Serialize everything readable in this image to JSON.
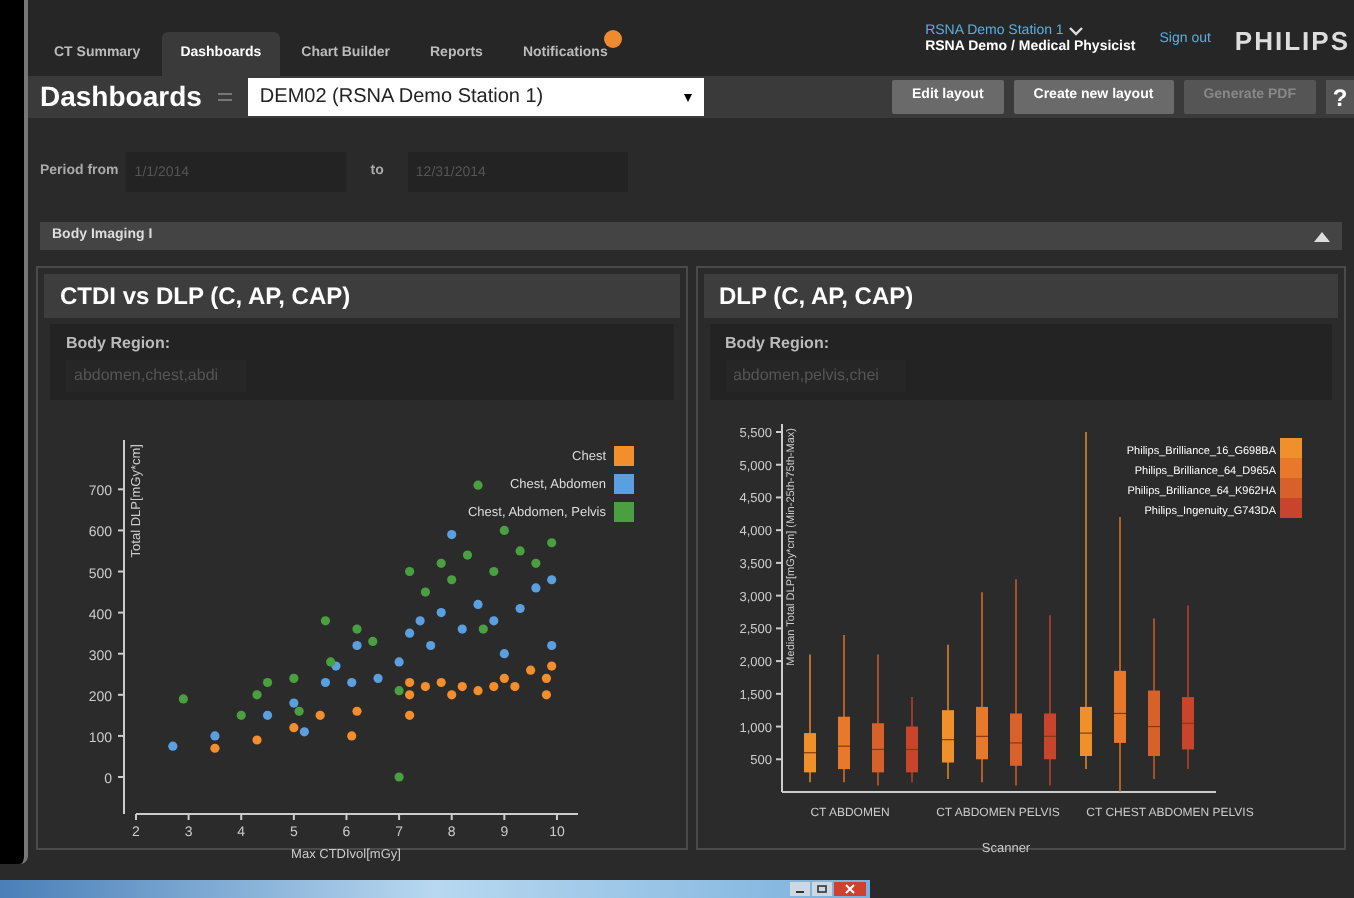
{
  "tabs": [
    {
      "label": "CT Summary",
      "selected": false
    },
    {
      "label": "Dashboards",
      "selected": true
    },
    {
      "label": "Chart Builder",
      "selected": false
    },
    {
      "label": "Reports",
      "selected": false
    },
    {
      "label": "Notifications",
      "selected": false,
      "badge": true
    }
  ],
  "user": {
    "station": "RSNA Demo Station 1",
    "role": "RSNA Demo / Medical Physicist"
  },
  "sign_out": "Sign out",
  "logo": "PHILIPS",
  "toolbar": {
    "title": "Dashboards",
    "dashboard_select": "DEM02 (RSNA Demo Station 1)",
    "buttons": [
      {
        "label": "Edit layout",
        "disabled": false
      },
      {
        "label": "Create new layout",
        "disabled": false
      },
      {
        "label": "Generate PDF",
        "disabled": true
      }
    ],
    "help": "?"
  },
  "period": {
    "from_label": "Period from",
    "from_placeholder": "1/1/2014",
    "to_label": "to",
    "to_placeholder": "12/31/2014"
  },
  "section": {
    "title": "Body Imaging I",
    "expanded": true
  },
  "panels": [
    {
      "title": "CTDI vs DLP (C, AP, CAP)",
      "filter_label": "Body Region:",
      "filter_placeholder": "abdomen,chest,abdi",
      "chart_data": {
        "type": "scatter",
        "xlabel": "Max CTDIvol[mGy]",
        "ylabel": "Total DLP[mGy*cm]",
        "xlim": [
          2,
          10.4
        ],
        "ylim": [
          -90,
          820
        ],
        "legend": "upper right",
        "xticks": [
          2,
          3,
          4,
          5,
          6,
          7,
          8,
          9,
          10
        ],
        "yticks": [
          0,
          100,
          200,
          300,
          400,
          500,
          600,
          700
        ],
        "series": [
          {
            "name": "Chest",
            "color": "#f28e2b",
            "x": [
              3.5,
              4.3,
              5,
              5.5,
              6.1,
              6.2,
              7.2,
              7.2,
              7.2,
              7.5,
              7.8,
              8,
              8.2,
              8.5,
              8.8,
              9,
              9.2,
              9.5,
              9.8,
              9.8,
              9.9
            ],
            "values": [
              70,
              90,
              120,
              150,
              100,
              160,
              150,
              200,
              230,
              220,
              230,
              200,
              220,
              210,
              220,
              240,
              220,
              260,
              200,
              240,
              270
            ]
          },
          {
            "name": "Chest, Abdomen",
            "color": "#5aa0e0",
            "x": [
              2.7,
              3.5,
              4.5,
              5,
              5.2,
              5.6,
              5.8,
              6.1,
              6.2,
              6.6,
              7,
              7.2,
              7.4,
              7.6,
              7.8,
              8,
              8.2,
              8.5,
              8.8,
              9,
              9.3,
              9.6,
              9.9,
              9.9
            ],
            "values": [
              75,
              100,
              150,
              180,
              110,
              230,
              270,
              230,
              320,
              240,
              280,
              350,
              380,
              320,
              400,
              590,
              360,
              420,
              380,
              300,
              410,
              460,
              480,
              320
            ]
          },
          {
            "name": "Chest, Abdomen, Pelvis",
            "color": "#4aa040",
            "x": [
              2.9,
              4,
              4.3,
              4.5,
              5,
              5.1,
              5.6,
              5.7,
              6.2,
              6.5,
              7,
              7,
              7.2,
              7.5,
              7.8,
              8,
              8.3,
              8.5,
              8.8,
              9,
              9.3,
              9.6,
              9.9,
              8.6
            ],
            "values": [
              190,
              150,
              200,
              230,
              240,
              160,
              380,
              280,
              360,
              330,
              210,
              0,
              500,
              450,
              520,
              480,
              540,
              710,
              500,
              600,
              550,
              520,
              570,
              360
            ]
          }
        ]
      }
    },
    {
      "title": "DLP (C, AP, CAP)",
      "filter_label": "Body Region:",
      "filter_placeholder": "abdomen,pelvis,chei",
      "box_plot": {
        "kind": "box",
        "xlabel": "Scanner",
        "ylabel": "Median Total DLP[mGy*cm] (Min-25th-75th-Max)",
        "categories": [
          "CT ABDOMEN",
          "CT ABDOMEN PELVIS",
          "CT CHEST ABDOMEN PELVIS"
        ],
        "ytick_labels": [
          "5,500",
          "5,000",
          "4,500",
          "4,000",
          "3,500",
          "3,000",
          "2,500",
          "2,000",
          "1,500",
          "1,000",
          "500"
        ],
        "scanners": [
          {
            "name": "Philips_Brilliance_16_G698BA",
            "color": "#f0902a"
          },
          {
            "name": "Philips_Brilliance_64_D965A",
            "color": "#e8782a"
          },
          {
            "name": "Philips_Brilliance_64_K962HA",
            "color": "#d8602a"
          },
          {
            "name": "Philips_Ingenuity_G743DA",
            "color": "#c8442a"
          }
        ]
      }
    }
  ]
}
